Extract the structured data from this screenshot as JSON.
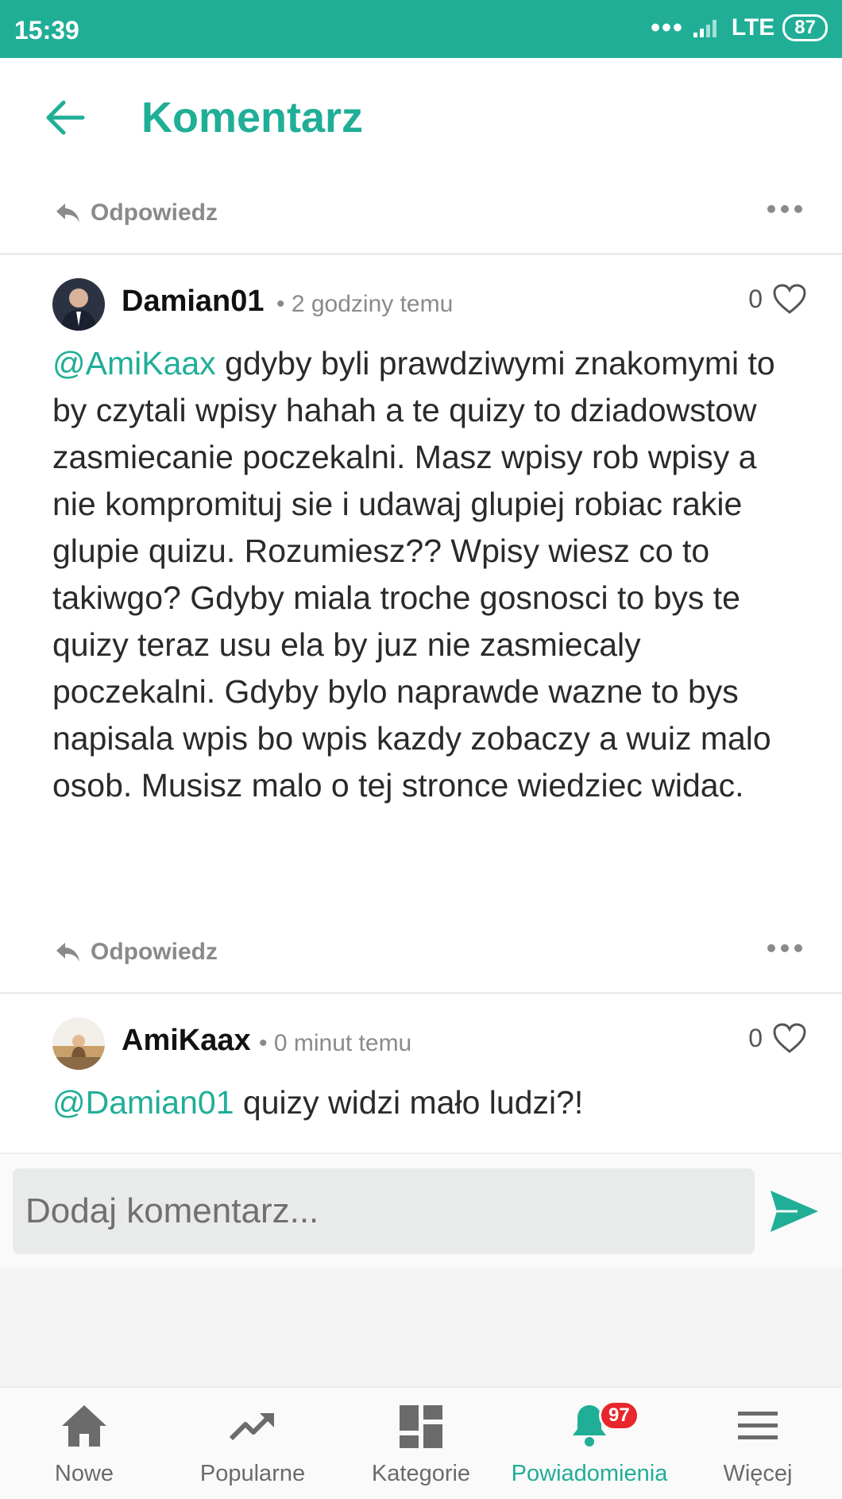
{
  "status_bar": {
    "time": "15:39",
    "network": "LTE",
    "battery": "87"
  },
  "header": {
    "title": "Komentarz"
  },
  "top_action": {
    "reply_label": "Odpowiedz"
  },
  "comments": [
    {
      "author": "Damian01",
      "time": "• 2 godziny temu",
      "likes": "0",
      "mention": "@AmiKaax",
      "text": " gdyby byli prawdziwymi znakomymi to by czytali wpisy hahah a te quizy to dziadowstow zasmiecanie poczekalni. Masz wpisy rob wpisy a nie kompromituj sie i udawaj glupiej robiac rakie glupie quizu. Rozumiesz?? Wpisy wiesz co to takiwgo? Gdyby miala troche gosnosci to bys te quizy teraz usu ela by juz nie zasmiecaly poczekalni. Gdyby bylo naprawde wazne to bys napisala wpis bo wpis kazdy zobaczy a wuiz malo osob. Musisz malo o tej stronce wiedziec widac.",
      "reply_label": "Odpowiedz"
    },
    {
      "author": "AmiKaax",
      "time": "• 0 minut temu",
      "likes": "0",
      "mention": "@Damian01",
      "text": " quizy widzi mało ludzi?!"
    }
  ],
  "input": {
    "placeholder": "Dodaj komentarz..."
  },
  "nav": [
    {
      "label": "Nowe"
    },
    {
      "label": "Popularne"
    },
    {
      "label": "Kategorie"
    },
    {
      "label": "Powiadomienia",
      "badge": "97"
    },
    {
      "label": "Więcej"
    }
  ],
  "colors": {
    "accent": "#20ae97",
    "badge": "#e8262b"
  }
}
